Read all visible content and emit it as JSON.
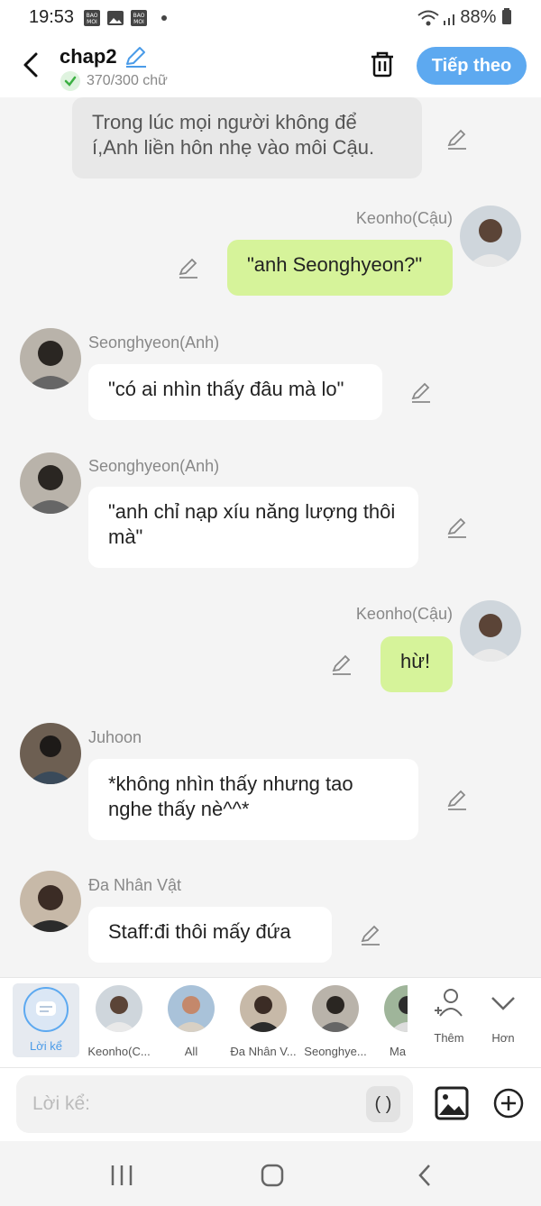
{
  "status": {
    "time": "19:53",
    "battery": "88%"
  },
  "header": {
    "title": "chap2",
    "word_count": "370/300 chữ",
    "next_label": "Tiếp theo"
  },
  "messages": [
    {
      "type": "narration",
      "text": "Trong lúc mọi người không để í,Anh liền hôn nhẹ vào môi Cậu."
    },
    {
      "type": "right",
      "name": "Keonho(Cậu)",
      "text": "\"anh Seonghyeon?\""
    },
    {
      "type": "left",
      "name": "Seonghyeon(Anh)",
      "text": "\"có ai nhìn thấy đâu mà lo\""
    },
    {
      "type": "left",
      "name": "Seonghyeon(Anh)",
      "text": "\"anh chỉ nạp xíu năng lượng thôi mà\""
    },
    {
      "type": "right",
      "name": "Keonho(Cậu)",
      "text": "hừ!"
    },
    {
      "type": "left",
      "name": "Juhoon",
      "text": "*không nhìn thấy nhưng tao nghe thấy nè^^*"
    },
    {
      "type": "left",
      "name": "Đa Nhân Vật",
      "text": "Staff:đi thôi mấy đứa"
    }
  ],
  "characters": [
    {
      "label": "Lời kể",
      "icon": "narration-icon"
    },
    {
      "label": "Keonho(C..."
    },
    {
      "label": "All"
    },
    {
      "label": "Đa Nhân V..."
    },
    {
      "label": "Seonghye..."
    },
    {
      "label": "Ma"
    },
    {
      "label": "Thêm",
      "icon": "add-person-icon"
    },
    {
      "label": "Hơn",
      "icon": "chevron-down-icon"
    }
  ],
  "input": {
    "placeholder": "Lời kể:",
    "paren_label": "( )"
  },
  "colors": {
    "accent": "#5da9f0",
    "right_bubble": "#d6f39a",
    "narration_bg": "#e8e8e8"
  }
}
